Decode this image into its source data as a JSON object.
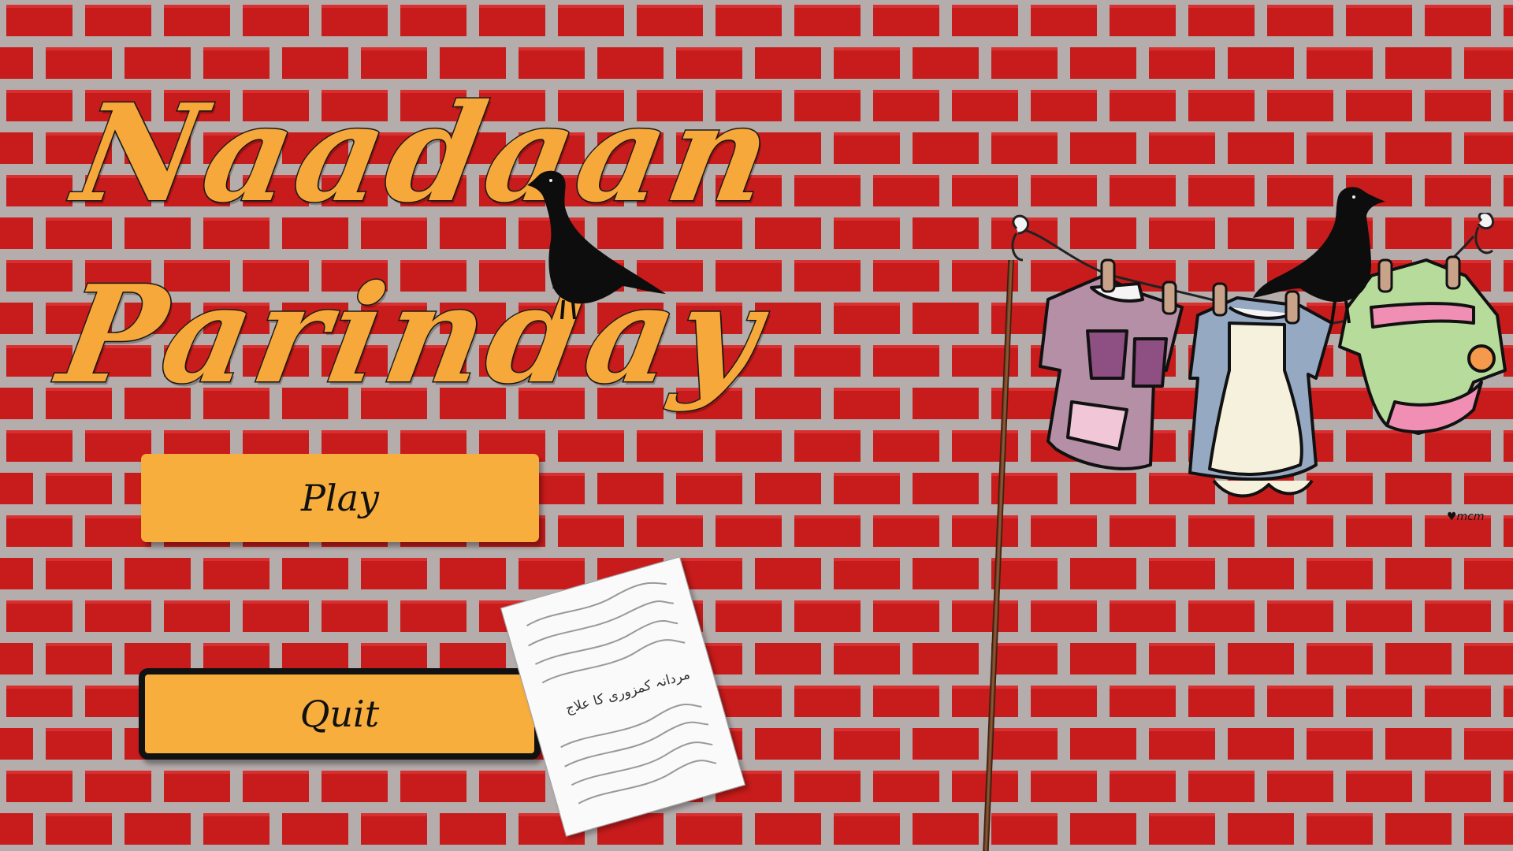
{
  "title": {
    "line1": "Naadaan",
    "line2": "Parinday"
  },
  "menu": {
    "play_label": "Play",
    "quit_label": "Quit"
  },
  "note": {
    "text": "مردانہ کمزوری کا علاج"
  },
  "signature": "♥mcm",
  "colors": {
    "brick": "#c61a1a",
    "mortar": "#b8b0b0",
    "title": "#f6a83a",
    "button": "#f8ae3c"
  },
  "icons": {
    "pigeon_left": "pigeon-icon",
    "pigeon_right": "pigeon-icon",
    "clothes": "clothesline-icon"
  }
}
